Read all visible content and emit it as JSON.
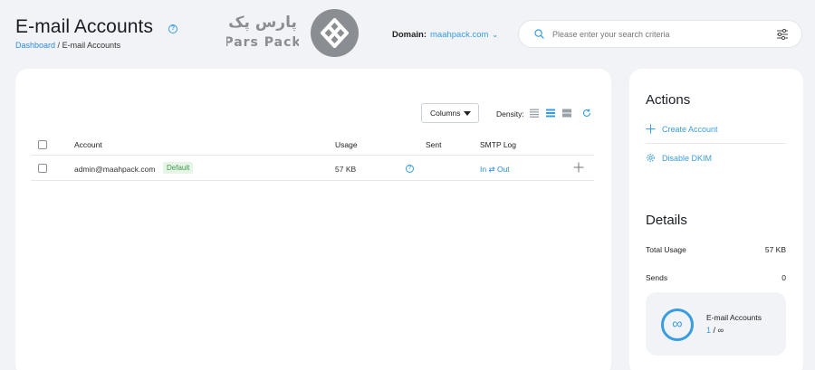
{
  "header": {
    "title": "E-mail Accounts",
    "breadcrumb": {
      "home": "Dashboard",
      "separator": "/",
      "current": "E-mail Accounts"
    }
  },
  "brand": {
    "name_fa": "پارس پک",
    "name_en": "Pars Pack"
  },
  "domain": {
    "label": "Domain:",
    "value": "maahpack.com"
  },
  "search": {
    "placeholder": "Please enter your search criteria"
  },
  "toolbar": {
    "columns_label": "Columns",
    "density_label": "Density:",
    "density_selected": "medium"
  },
  "table": {
    "headers": {
      "account": "Account",
      "usage": "Usage",
      "sent": "Sent",
      "smtp_log": "SMTP Log"
    },
    "rows": [
      {
        "account": "admin@maahpack.com",
        "badge": "Default",
        "usage": "57 KB",
        "smtp_in": "In",
        "smtp_sep": "⇄",
        "smtp_out": "Out"
      }
    ]
  },
  "actions": {
    "title": "Actions",
    "items": [
      {
        "label": "Create Account",
        "icon": "plus-icon"
      },
      {
        "label": "Disable DKIM",
        "icon": "gear-icon"
      }
    ]
  },
  "details": {
    "title": "Details",
    "total_usage_label": "Total Usage",
    "total_usage_value": "57 KB",
    "sends_label": "Sends",
    "sends_value": "0",
    "accounts_label": "E-mail Accounts",
    "accounts_used": "1",
    "accounts_sep": "/",
    "accounts_limit": "∞",
    "infinity_symbol": "∞"
  },
  "colors": {
    "accent": "#3a9de0",
    "background": "#f1f3f7",
    "success_bg": "#e6f5e8",
    "success_text": "#3c9a4c"
  }
}
